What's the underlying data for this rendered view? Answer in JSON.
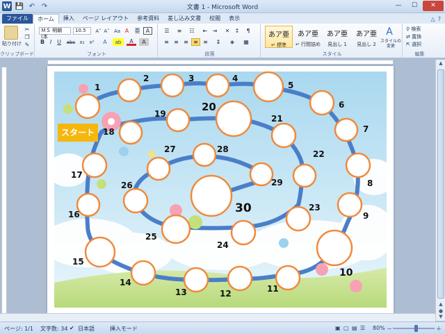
{
  "window": {
    "title": "文書 1 - Microsoft Word",
    "min": "—",
    "max": "☐",
    "close": "✕"
  },
  "qat": {
    "app_icon": "W",
    "save": "💾",
    "undo": "↶",
    "redo": "↷"
  },
  "tabs": [
    {
      "label": "ファイル"
    },
    {
      "label": "ホーム"
    },
    {
      "label": "挿入"
    },
    {
      "label": "ページ レイアウト"
    },
    {
      "label": "参考資料"
    },
    {
      "label": "差し込み文書"
    },
    {
      "label": "校閲"
    },
    {
      "label": "表示"
    }
  ],
  "tab_right": {
    "minimize_ribbon": "△",
    "help": "?"
  },
  "ribbon": {
    "clipboard": {
      "paste": "貼り付け",
      "label": "クリップボード"
    },
    "font": {
      "name": "ＭＳ 明朝 (本",
      "size": "10.5",
      "label": "フォント",
      "bold": "B",
      "italic": "I",
      "underline": "U",
      "strike": "abc",
      "sub": "x₂",
      "sup": "x²",
      "grow": "A˄",
      "shrink": "A˅",
      "case": "Aa",
      "clear": "A",
      "highlight": "ab",
      "color": "A",
      "phonetic": "亜",
      "border": "A"
    },
    "paragraph": {
      "label": "段落"
    },
    "styles": {
      "label": "スタイル",
      "items": [
        {
          "sample": "あア亜",
          "name": "↵ 標準"
        },
        {
          "sample": "あア亜",
          "name": "↵ 行間詰め"
        },
        {
          "sample": "あア亜",
          "name": "見出し 1"
        },
        {
          "sample": "あア亜",
          "name": "見出し 2"
        }
      ],
      "change": "スタイルの変更"
    },
    "editing": {
      "label": "編集",
      "find": "検索",
      "replace": "置換",
      "select": "選択"
    }
  },
  "document": {
    "start_label": "スタート",
    "board_numbers": [
      "1",
      "2",
      "3",
      "4",
      "5",
      "6",
      "7",
      "8",
      "9",
      "10",
      "11",
      "12",
      "13",
      "14",
      "15",
      "16",
      "17",
      "18",
      "19",
      "20",
      "21",
      "22",
      "23",
      "24",
      "25",
      "26",
      "27",
      "28",
      "29",
      "30"
    ]
  },
  "statusbar": {
    "page": "ページ: 1/1",
    "words": "文字数: 34",
    "language": "日本語",
    "mode": "挿入モード",
    "zoom": "80%",
    "zoom_minus": "－",
    "zoom_plus": "＋"
  },
  "colors": {
    "path": "#4a7ec8",
    "circle_border": "#f08a3c",
    "sky": "#bfe1f3",
    "start_bg": "#f6b70d"
  }
}
